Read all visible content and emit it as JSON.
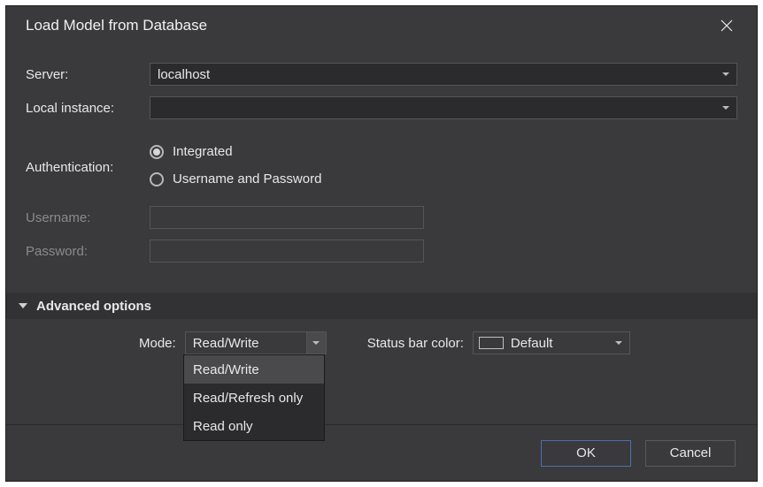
{
  "title": "Load Model from Database",
  "fields": {
    "server_label": "Server:",
    "server_value": "localhost",
    "local_instance_label": "Local instance:",
    "local_instance_value": "",
    "authentication_label": "Authentication:",
    "auth_integrated": "Integrated",
    "auth_userpass": "Username and Password",
    "username_label": "Username:",
    "password_label": "Password:"
  },
  "advanced": {
    "header": "Advanced options",
    "mode_label": "Mode:",
    "mode_value": "Read/Write",
    "mode_options": [
      "Read/Write",
      "Read/Refresh only",
      "Read only"
    ],
    "status_label": "Status bar color:",
    "status_value": "Default"
  },
  "buttons": {
    "ok": "OK",
    "cancel": "Cancel"
  }
}
